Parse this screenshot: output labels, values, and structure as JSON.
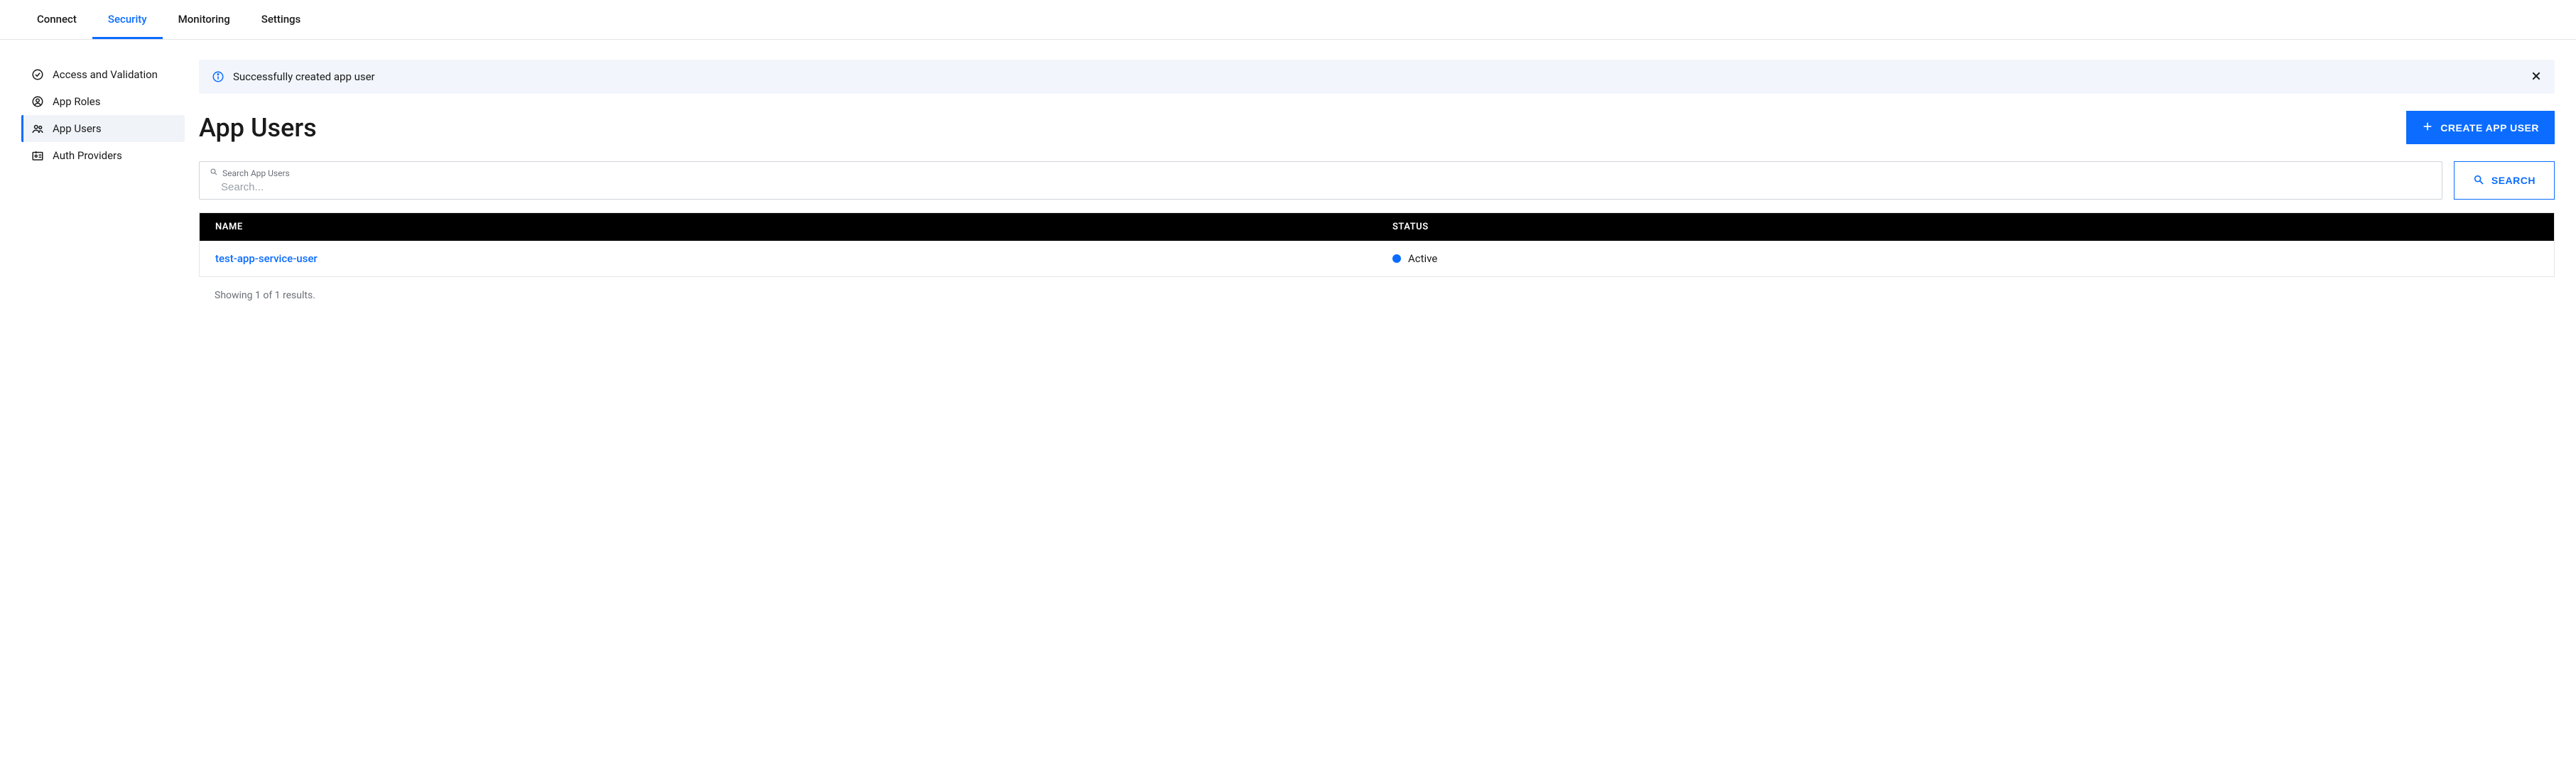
{
  "tabs": [
    {
      "label": "Connect",
      "active": false
    },
    {
      "label": "Security",
      "active": true
    },
    {
      "label": "Monitoring",
      "active": false
    },
    {
      "label": "Settings",
      "active": false
    }
  ],
  "sidebar": {
    "items": [
      {
        "label": "Access and Validation",
        "icon": "check-shield-icon",
        "active": false
      },
      {
        "label": "App Roles",
        "icon": "user-circle-icon",
        "active": false
      },
      {
        "label": "App Users",
        "icon": "users-icon",
        "active": true
      },
      {
        "label": "Auth Providers",
        "icon": "id-card-icon",
        "active": false
      }
    ]
  },
  "alert": {
    "message": "Successfully created app user"
  },
  "page": {
    "title": "App Users",
    "create_button": "CREATE APP USER"
  },
  "search": {
    "label": "Search App Users",
    "placeholder": "Search...",
    "value": "",
    "button": "SEARCH"
  },
  "table": {
    "headers": {
      "name": "NAME",
      "status": "STATUS"
    },
    "rows": [
      {
        "name": "test-app-service-user",
        "status": "Active",
        "status_color": "#0b6cff"
      }
    ]
  },
  "results_text": "Showing 1 of 1 results."
}
